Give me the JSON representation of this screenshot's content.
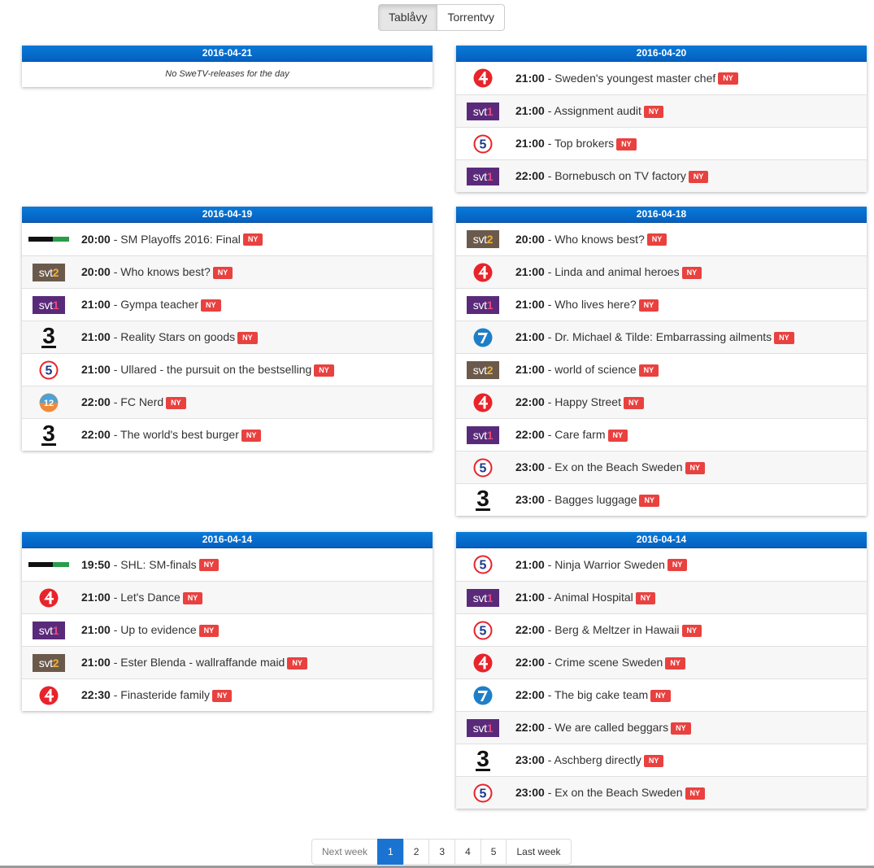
{
  "toggle": {
    "tab1": "Tablåvy",
    "tab2": "Torrentvy"
  },
  "ny_label": "NY",
  "days": [
    {
      "date": "2016-04-21",
      "empty": "No SweTV-releases for the day",
      "items": []
    },
    {
      "date": "2016-04-20",
      "items": [
        {
          "channel": "tv4",
          "time": "21:00",
          "title": "Sweden's youngest master chef"
        },
        {
          "channel": "svt1",
          "time": "21:00",
          "title": "Assignment audit"
        },
        {
          "channel": "kanal5",
          "time": "21:00",
          "title": "Top brokers"
        },
        {
          "channel": "svt1",
          "time": "22:00",
          "title": "Bornebusch on TV factory"
        }
      ]
    },
    {
      "date": "2016-04-19",
      "items": [
        {
          "channel": "canal-hockey",
          "time": "20:00",
          "title": "SM Playoffs 2016: Final"
        },
        {
          "channel": "svt2",
          "time": "20:00",
          "title": "Who knows best?"
        },
        {
          "channel": "svt1",
          "time": "21:00",
          "title": "Gympa teacher"
        },
        {
          "channel": "tv3",
          "time": "21:00",
          "title": "Reality Stars on goods"
        },
        {
          "channel": "kanal5",
          "time": "21:00",
          "title": "Ullared - the pursuit on the bestselling"
        },
        {
          "channel": "kanal12",
          "time": "22:00",
          "title": "FC Nerd"
        },
        {
          "channel": "tv3",
          "time": "22:00",
          "title": "The world's best burger"
        }
      ]
    },
    {
      "date": "2016-04-18",
      "items": [
        {
          "channel": "svt2",
          "time": "20:00",
          "title": "Who knows best?"
        },
        {
          "channel": "tv4",
          "time": "21:00",
          "title": "Linda and animal heroes"
        },
        {
          "channel": "svt1",
          "time": "21:00",
          "title": "Who lives here?"
        },
        {
          "channel": "sjuan",
          "time": "21:00",
          "title": "Dr. Michael & Tilde: Embarrassing ailments"
        },
        {
          "channel": "svt2",
          "time": "21:00",
          "title": "world of science"
        },
        {
          "channel": "tv4",
          "time": "22:00",
          "title": "Happy Street"
        },
        {
          "channel": "svt1",
          "time": "22:00",
          "title": "Care farm"
        },
        {
          "channel": "kanal5",
          "time": "23:00",
          "title": "Ex on the Beach Sweden"
        },
        {
          "channel": "tv3",
          "time": "23:00",
          "title": "Bagges luggage"
        }
      ]
    },
    {
      "date": "2016-04-14",
      "items": [
        {
          "channel": "canal-hockey",
          "time": "19:50",
          "title": "SHL: SM-finals"
        },
        {
          "channel": "tv4",
          "time": "21:00",
          "title": "Let's Dance"
        },
        {
          "channel": "svt1",
          "time": "21:00",
          "title": "Up to evidence"
        },
        {
          "channel": "svt2",
          "time": "21:00",
          "title": "Ester Blenda - wallraffande maid"
        },
        {
          "channel": "tv4",
          "time": "22:30",
          "title": "Finasteride family"
        }
      ]
    },
    {
      "date": "2016-04-14",
      "items": [
        {
          "channel": "kanal5",
          "time": "21:00",
          "title": "Ninja Warrior Sweden"
        },
        {
          "channel": "svt1",
          "time": "21:00",
          "title": "Animal Hospital"
        },
        {
          "channel": "kanal5",
          "time": "22:00",
          "title": "Berg & Meltzer in Hawaii"
        },
        {
          "channel": "tv4",
          "time": "22:00",
          "title": "Crime scene Sweden"
        },
        {
          "channel": "sjuan",
          "time": "22:00",
          "title": "The big cake team"
        },
        {
          "channel": "svt1",
          "time": "22:00",
          "title": "We are called beggars"
        },
        {
          "channel": "tv3",
          "time": "23:00",
          "title": "Aschberg directly"
        },
        {
          "channel": "kanal5",
          "time": "23:00",
          "title": "Ex on the Beach Sweden"
        }
      ]
    }
  ],
  "pagination": {
    "prev": "Next week",
    "pages": [
      "1",
      "2",
      "3",
      "4",
      "5"
    ],
    "active": "1",
    "next": "Last week"
  }
}
